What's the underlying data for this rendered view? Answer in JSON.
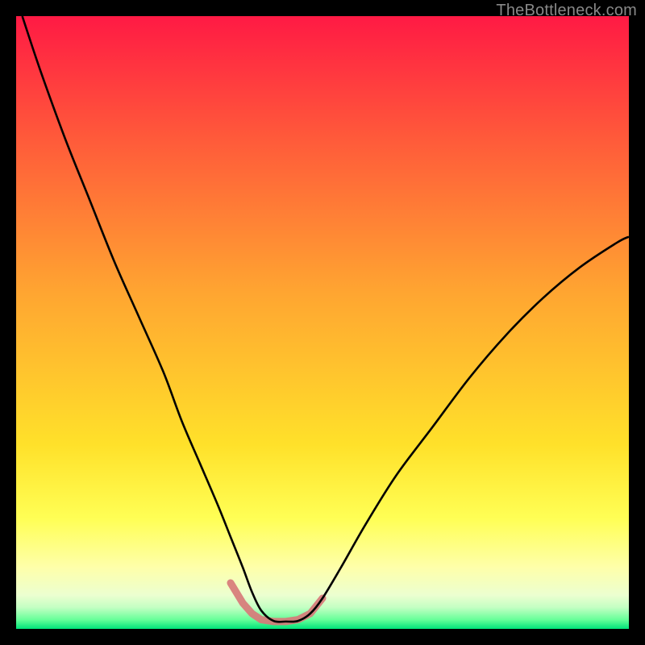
{
  "watermark": "TheBottleneck.com",
  "chart_data": {
    "type": "line",
    "title": "",
    "xlabel": "",
    "ylabel": "",
    "xlim": [
      0,
      100
    ],
    "ylim": [
      0,
      100
    ],
    "background_gradient": {
      "stops": [
        {
          "pos": 0.0,
          "color": "#ff1a44"
        },
        {
          "pos": 0.2,
          "color": "#ff5a3a"
        },
        {
          "pos": 0.45,
          "color": "#ffa531"
        },
        {
          "pos": 0.7,
          "color": "#ffe12a"
        },
        {
          "pos": 0.82,
          "color": "#ffff55"
        },
        {
          "pos": 0.9,
          "color": "#feffaa"
        },
        {
          "pos": 0.945,
          "color": "#ecffd0"
        },
        {
          "pos": 0.965,
          "color": "#c3ffc3"
        },
        {
          "pos": 0.985,
          "color": "#66ff99"
        },
        {
          "pos": 1.0,
          "color": "#00e37a"
        }
      ]
    },
    "series": [
      {
        "name": "bottleneck-curve",
        "stroke": "#000000",
        "stroke_width": 2.6,
        "fill": "none",
        "x": [
          1,
          4,
          8,
          12,
          16,
          20,
          24,
          27,
          30,
          33,
          35,
          37,
          38.5,
          40,
          42,
          44,
          46,
          48,
          50,
          53,
          57,
          62,
          68,
          74,
          80,
          86,
          92,
          98,
          100
        ],
        "y": [
          100,
          91,
          80,
          70,
          60,
          51,
          42,
          34,
          27,
          20,
          15,
          10,
          6,
          3,
          1.3,
          1.2,
          1.3,
          2.5,
          5,
          10,
          17,
          25,
          33,
          41,
          48,
          54,
          59,
          63,
          64
        ]
      },
      {
        "name": "marker-cluster",
        "type": "scatter",
        "stroke": "#d87a7a",
        "stroke_width": 9,
        "linecap": "round",
        "x": [
          35,
          37,
          38.5,
          40,
          42,
          44,
          46,
          48,
          50
        ],
        "y": [
          7.5,
          4.2,
          2.5,
          1.5,
          1.2,
          1.2,
          1.5,
          2.5,
          5
        ]
      }
    ]
  }
}
